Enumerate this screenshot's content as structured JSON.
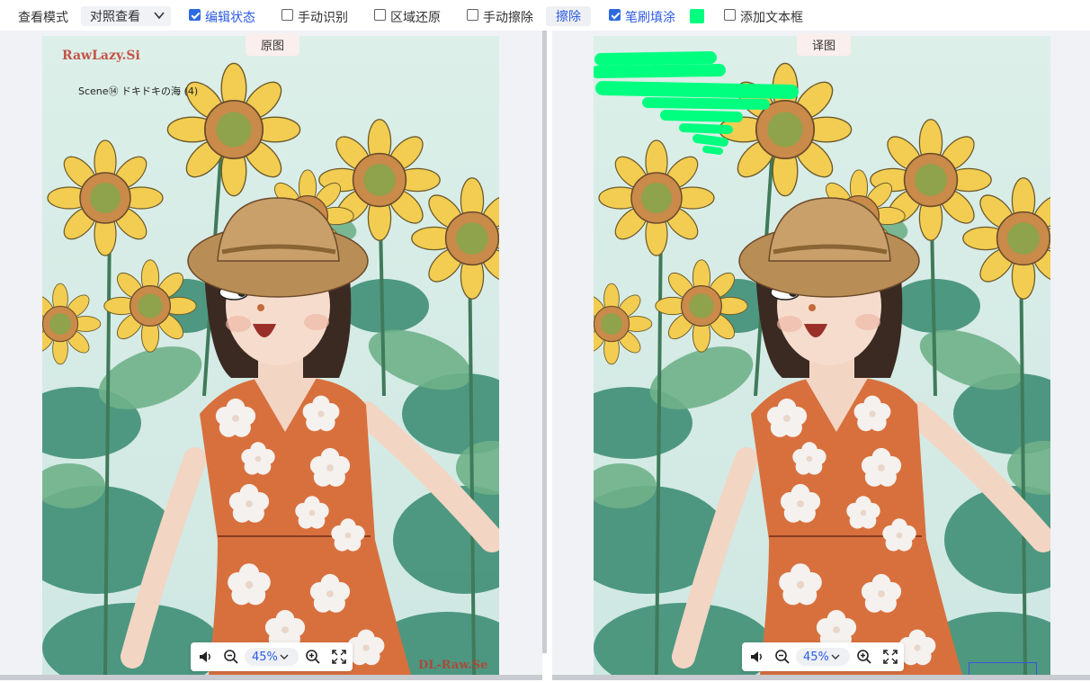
{
  "toolbar": {
    "view_mode_label": "查看模式",
    "view_mode_value": "对照查看",
    "edit_state_label": "编辑状态",
    "edit_state_checked": true,
    "manual_detect_label": "手动识别",
    "manual_detect_checked": false,
    "region_restore_label": "区域还原",
    "region_restore_checked": false,
    "manual_erase_label": "手动擦除",
    "manual_erase_checked": false,
    "erase_button": "擦除",
    "brush_fill_label": "笔刷填涂",
    "brush_fill_checked": true,
    "brush_color": "#00ff7f",
    "add_textbox_label": "添加文本框",
    "add_textbox_checked": false
  },
  "left_pane": {
    "label": "原图",
    "watermark_top": "RawLazy.Si",
    "scene_text": "Scene⑭ ドキドキの海 (4)",
    "watermark_bottom": "DL-Raw.Se",
    "zoom": "45%",
    "icons": [
      "speaker-icon",
      "zoom-out-icon",
      "zoom-in-icon",
      "fullscreen-icon"
    ]
  },
  "right_pane": {
    "label": "译图",
    "zoom": "45%",
    "icons": [
      "speaker-icon",
      "zoom-out-icon",
      "zoom-in-icon",
      "fullscreen-icon"
    ]
  },
  "colors": {
    "accent": "#2d5be3",
    "brush": "#00ff7f",
    "pane_bg": "#f0f2f5"
  }
}
